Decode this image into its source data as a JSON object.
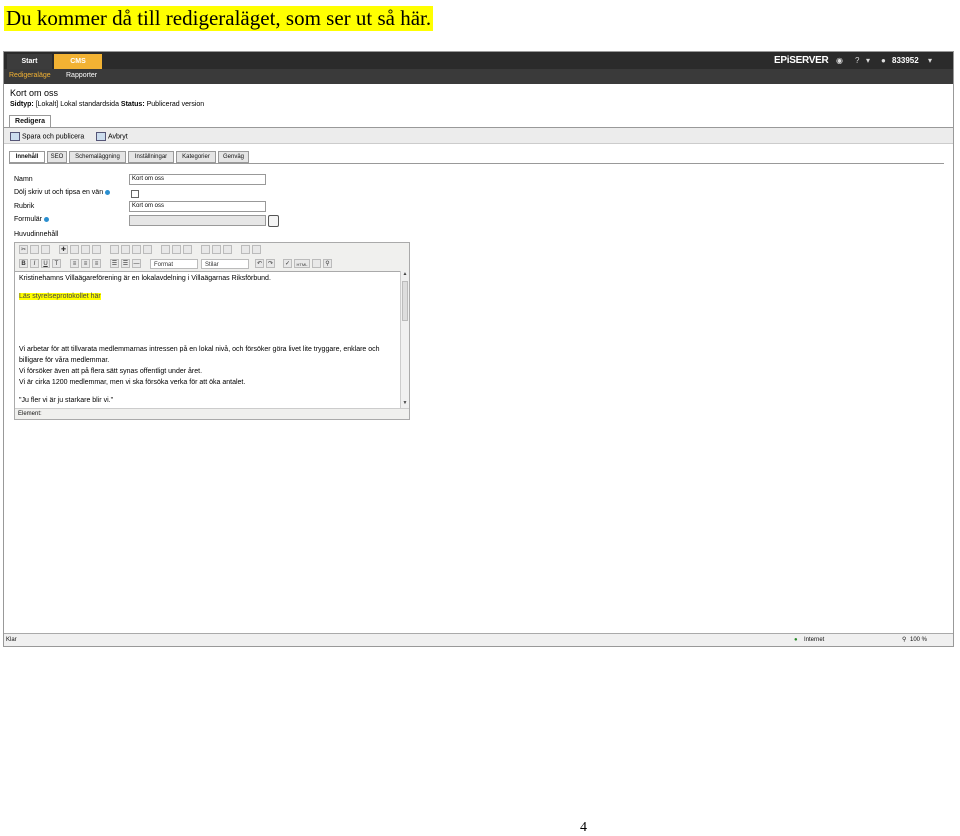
{
  "heading": "Du kommer då till redigeraläget, som ser ut så här.",
  "topbar": {
    "tab_start": "Start",
    "tab_cms": "CMS",
    "logo": "EPiSERVER",
    "help": "?",
    "user": "833952"
  },
  "subnav": {
    "edit_mode": "Redigeraläge",
    "reports": "Rapporter"
  },
  "page": {
    "title": "Kort om oss",
    "type_label": "Sidtyp:",
    "type_value": "[Lokalt] Lokal standardsida",
    "status_label": "Status:",
    "status_value": "Publicerad version"
  },
  "edit_tab": "Redigera",
  "actions": {
    "save_publish": "Spara och publicera",
    "cancel": "Avbryt"
  },
  "content_tabs": [
    "Innehåll",
    "SEO",
    "Schemaläggning",
    "Inställningar",
    "Kategorier",
    "Genväg"
  ],
  "form": {
    "name_label": "Namn",
    "name_value": "Kort om oss",
    "hide_label": "Dölj skriv ut och tipsa en vän",
    "heading_label": "Rubrik",
    "heading_value": "Kort om oss",
    "form_label": "Formulär",
    "main_content_label": "Huvudinnehåll"
  },
  "editor": {
    "format_select": "Format",
    "style_select": "Stilar",
    "html_button": "HTML",
    "line1": "Kristinehamns Villaägareförening är en lokalavdelning i Villaägarnas Riksförbund.",
    "link": "Läs styrelseprotokollet här",
    "line2": "Vi arbetar för att tillvarata medlemmarnas intressen på en lokal nivå, och försöker göra livet lite tryggare, enklare och billigare för våra medlemmar.",
    "line3": "Vi försöker även att på flera sätt synas offentligt under året.",
    "line4": "Vi är cirka 1200 medlemmar, men vi ska försöka verka för att öka antalet.",
    "line5": "\"Ju fler vi är ju starkare blir vi.\"",
    "status": "Element:"
  },
  "statusbar": {
    "left": "Klar",
    "zone": "Internet",
    "zoom": "100 %"
  },
  "page_number": "4"
}
